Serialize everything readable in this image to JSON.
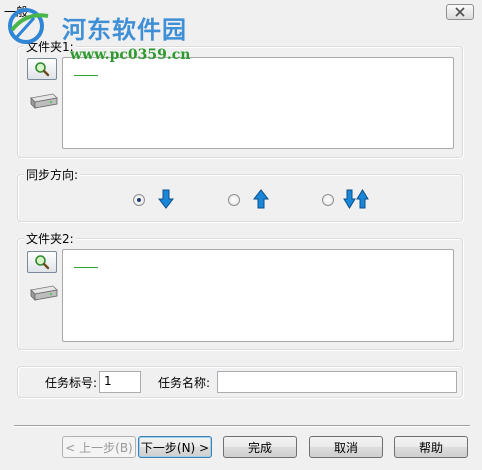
{
  "window": {
    "title": "一般"
  },
  "watermark": {
    "title": "河东软件园",
    "url": "www.pc0359.cn"
  },
  "folder1": {
    "label": "文件夹1:"
  },
  "sync": {
    "label": "同步方向:",
    "selected": "left-to-right"
  },
  "folder2": {
    "label": "文件夹2:"
  },
  "task": {
    "number_label": "任务标号:",
    "number_value": "1",
    "name_label": "任务名称:",
    "name_value": ""
  },
  "buttons": {
    "prev": "< 上一步(B)",
    "next": "下一步(N) >",
    "finish": "完成",
    "cancel": "取消",
    "help": "帮助"
  },
  "colors": {
    "accent": "#1a86d8",
    "watermark_blue": "#3f8fd6",
    "watermark_green": "#2e9a2e"
  }
}
